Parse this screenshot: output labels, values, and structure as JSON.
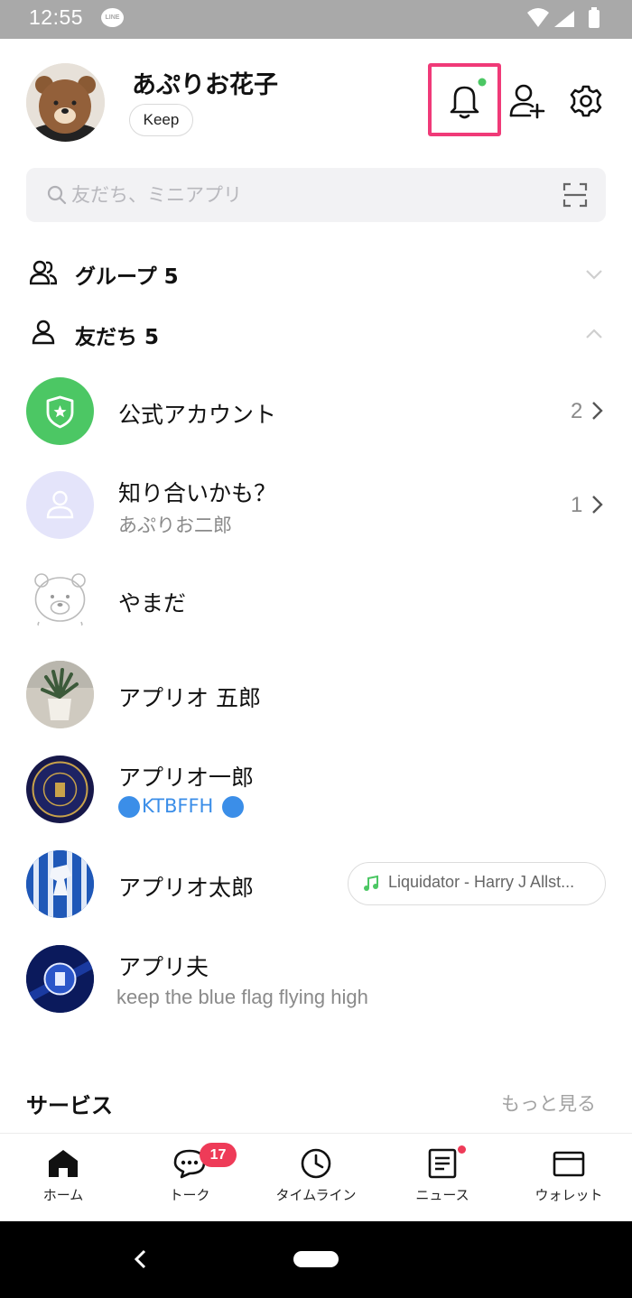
{
  "status_bar": {
    "time": "12:55",
    "notification_app": "LINE"
  },
  "profile": {
    "name": "あぷりお花子",
    "keep_label": "Keep"
  },
  "header_icons": [
    "bell-icon",
    "add-friend-icon",
    "settings-icon"
  ],
  "search": {
    "placeholder": "友だち、ミニアプリ"
  },
  "sections": {
    "groups": {
      "label": "グループ 5"
    },
    "friends": {
      "label": "友だち 5"
    }
  },
  "list": [
    {
      "name": "公式アカウント",
      "count": "2"
    },
    {
      "name": "知り合いかも？",
      "sub": "あぷりお二郎",
      "count": "1"
    },
    {
      "name": "やまだ"
    },
    {
      "name": "アプリオ 五郎"
    },
    {
      "name": "アプリオ一郎",
      "sub": "KTBFFH"
    },
    {
      "name": "アプリオ太郎",
      "music": "Liquidator - Harry J Allst..."
    },
    {
      "name": "アプリ夫",
      "sub": "keep the blue flag flying high"
    }
  ],
  "services": {
    "title": "サービス",
    "more": "もっと見る"
  },
  "bottom_nav": {
    "home": "ホーム",
    "talk": "トーク",
    "timeline": "タイムライン",
    "news": "ニュース",
    "wallet": "ウォレット",
    "talk_badge": "17"
  },
  "colors": {
    "accent_green": "#4cc764",
    "badge_red": "#ee3b58",
    "highlight_pink": "#f03a78"
  }
}
